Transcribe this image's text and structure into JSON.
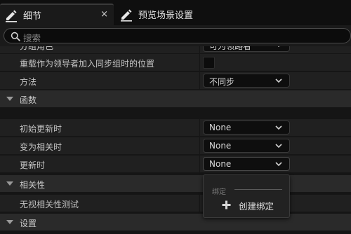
{
  "tabs": [
    {
      "label": "细节",
      "icon": "pencil-icon",
      "close": "×",
      "active": true
    },
    {
      "label": "预览场景设置",
      "icon": "pencil-icon",
      "active": false
    }
  ],
  "search": {
    "placeholder": "搜索",
    "value": ""
  },
  "properties": {
    "group_role": {
      "label": "分组角色",
      "value": "可为领路者"
    },
    "retain_position": {
      "label": "重载作为领导者加入同步组时的位置",
      "checked": false
    },
    "method": {
      "label": "方法",
      "value": "不同步"
    }
  },
  "categories": {
    "functions": "函数",
    "relevancy": "相关性",
    "settings": "设置"
  },
  "functions": {
    "init_update": {
      "label": "初始更新时",
      "value": "None"
    },
    "become_relevant": {
      "label": "变为相关时",
      "value": "None"
    },
    "on_update": {
      "label": "更新时",
      "value": "None"
    }
  },
  "relevancy": {
    "ignore_test": {
      "label": "无视相关性测试"
    }
  },
  "binding_popup": {
    "section": "绑定",
    "create_binding": "创建绑定"
  }
}
